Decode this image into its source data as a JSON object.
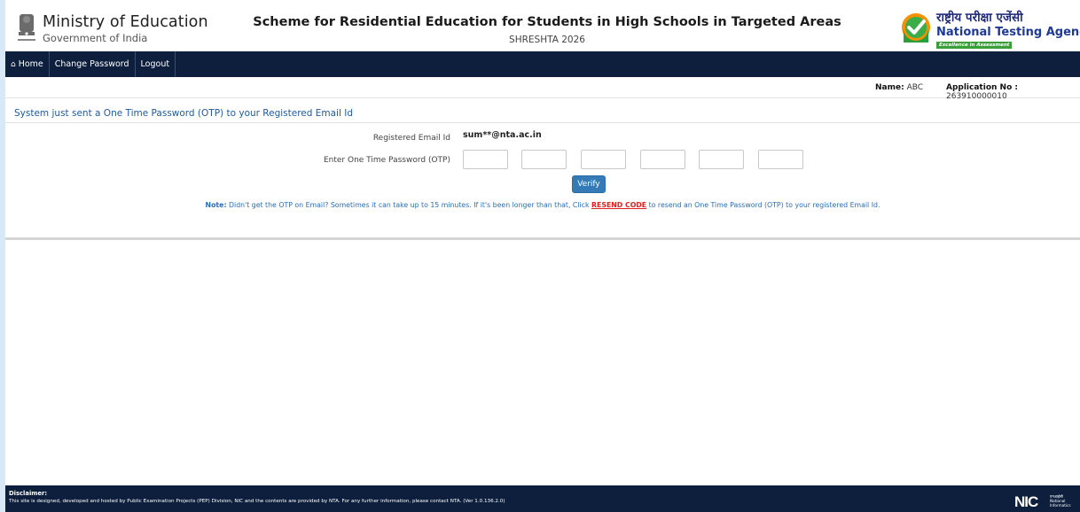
{
  "header": {
    "ministry_title": "Ministry of Education",
    "ministry_subtitle": "Government of India",
    "emblem_caption": "सत्यमेव जयते",
    "scheme_title": "Scheme for Residential Education for Students in High Schools in Targeted Areas",
    "scheme_subtitle": "SHRESHTA 2026",
    "agency_hindi": "राष्ट्रीय परीक्षा एजेंसी",
    "agency_english": "National Testing Agency",
    "agency_tagline": "Excellence in Assessment"
  },
  "nav": {
    "items": [
      {
        "label": "Home",
        "icon": "home-icon"
      },
      {
        "label": "Change Password"
      },
      {
        "label": "Logout"
      }
    ]
  },
  "candidate": {
    "name_label": "Name:",
    "name_value": "ABC",
    "app_label": "Application No :",
    "app_value": "263910000010"
  },
  "otp": {
    "section_title": "System just sent a One Time Password (OTP) to your Registered Email Id",
    "email_label": "Registered Email Id",
    "email_value": "sum**@nta.ac.in",
    "otp_label": "Enter One Time Password (OTP)",
    "box_count": 6,
    "verify_label": "Verify",
    "note_label": "Note:",
    "note_text_1": " Didn't get the OTP on Email? Sometimes it can take up to 15 minutes. If it's been longer than that, Click ",
    "resend_label": "RESEND CODE",
    "note_text_2": " to resend an One Time Password (OTP) to your registered Email Id."
  },
  "footer": {
    "disclaimer_title": "Disclaimer:",
    "disclaimer_text": "This site is designed, developed and hosted by Public Examination Projects (PEP) Division, NIC and the contents are provided by NTA. For any further information, please contact NTA. (Ver 1.0.136.2.0)",
    "nic_mark": "NIC",
    "nic_hindi": "एनआईसी",
    "nic_line1": "National",
    "nic_line2": "Informatics"
  },
  "colors": {
    "nav_bg": "#0d1f3d",
    "accent_blue": "#337ab7",
    "resend_red": "#e02020",
    "title_blue": "#1e5a9e"
  }
}
